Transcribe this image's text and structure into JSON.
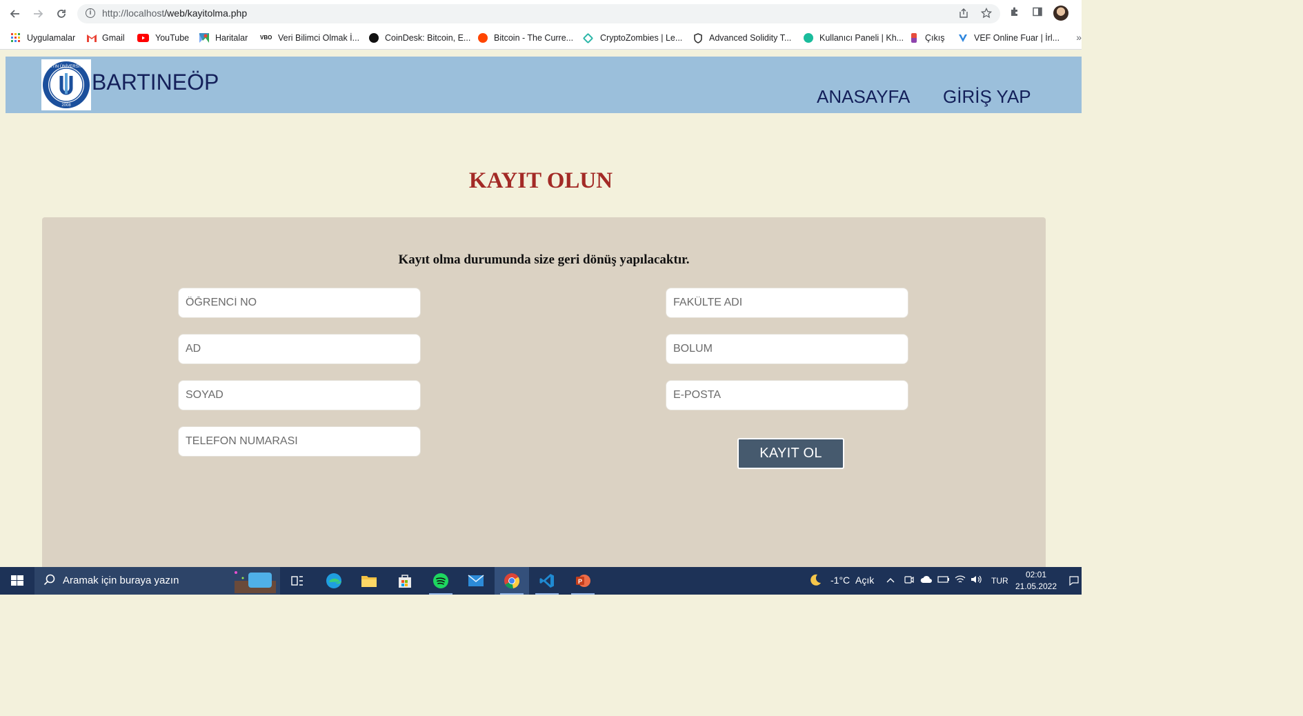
{
  "browser": {
    "url_host": "http://localhost",
    "url_path": "/web/kayitolma.php"
  },
  "bookmarks": [
    {
      "label": "Uygulamalar",
      "icon": "apps-grid-icon",
      "color": "#ea4335"
    },
    {
      "label": "Gmail",
      "icon": "gmail-icon",
      "color": "#ea4335"
    },
    {
      "label": "YouTube",
      "icon": "youtube-icon",
      "color": "#ff0000"
    },
    {
      "label": "Haritalar",
      "icon": "maps-icon",
      "color": "#34a853"
    },
    {
      "label": "Veri Bilimci Olmak İ...",
      "icon": "vbo-icon",
      "color": "#111111"
    },
    {
      "label": "CoinDesk: Bitcoin, E...",
      "icon": "coindesk-icon",
      "color": "#111111"
    },
    {
      "label": "Bitcoin - The Curre...",
      "icon": "reddit-icon",
      "color": "#ff4500"
    },
    {
      "label": "CryptoZombies | Le...",
      "icon": "cryptozombies-icon",
      "color": "#2bb6a8"
    },
    {
      "label": "Advanced Solidity T...",
      "icon": "shield-icon",
      "color": "#333333"
    },
    {
      "label": "Kullanıcı Paneli | Kh...",
      "icon": "kh-icon",
      "color": "#1abc9c"
    },
    {
      "label": "Çıkış",
      "icon": "exit-icon",
      "color": "#8e44ad"
    },
    {
      "label": "VEF Online Fuar | İrl...",
      "icon": "vef-icon",
      "color": "#2e86de"
    }
  ],
  "header": {
    "brand": "BARTINEÖP",
    "nav": [
      "ANASAYFA",
      "GİRİŞ YAP"
    ],
    "logo_text": "BARTIN ÜNİVERSİTESİ",
    "logo_year": "2008"
  },
  "page": {
    "title": "KAYIT OLUN",
    "subtitle": "Kayıt olma durumunda size geri dönüş yapılacaktır.",
    "left_fields": [
      "ÖĞRENCİ NO",
      "AD",
      "SOYAD",
      "TELEFON NUMARASI"
    ],
    "right_fields": [
      "FAKÜLTE ADI",
      "BOLUM",
      "E-POSTA"
    ],
    "submit": "KAYIT OL"
  },
  "taskbar": {
    "search_placeholder": "Aramak için buraya yazın",
    "weather": "-1°C",
    "weather_state": "Açık",
    "language": "TUR",
    "time": "02:01",
    "date": "21.05.2022"
  },
  "colors": {
    "header_bg": "#9bbfdb",
    "page_bg": "#f3f1dc",
    "panel_bg": "#dbd2c3",
    "title": "#a32a26",
    "submit_bg": "#465a6e",
    "taskbar_bg": "#1d3257"
  }
}
